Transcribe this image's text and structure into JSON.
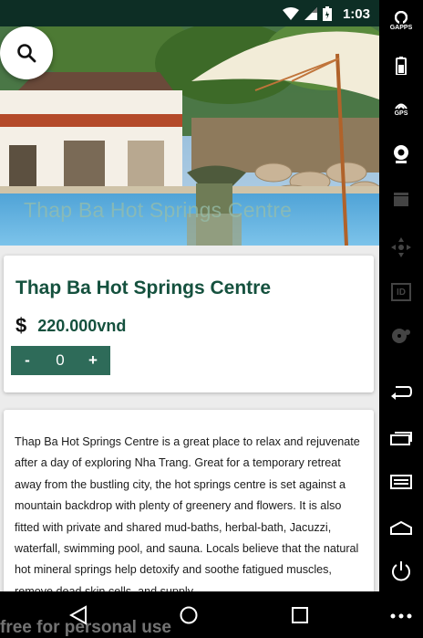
{
  "status_bar": {
    "time": "1:03"
  },
  "hero": {
    "overlay_title": "Thap Ba Hot Springs Centre"
  },
  "search": {
    "icon": "search-icon"
  },
  "product": {
    "title": "Thap Ba Hot Springs Centre",
    "currency_symbol": "$",
    "price": "220.000vnd",
    "stepper": {
      "minus": "-",
      "quantity": "0",
      "plus": "+"
    }
  },
  "description": {
    "text": "Thap Ba Hot Springs Centre is a great place to relax and rejuvenate after a day of exploring Nha Trang. Great for a temporary retreat away from the bustling city, the hot springs centre is set against a mountain backdrop with plenty of greenery and flowers. It is also fitted with private and shared mud-baths, herbal-bath, Jacuzzi, waterfall, swimming pool, and sauna. Locals believe that the natural hot mineral springs help detoxify and soothe fatigued muscles, remove dead skin cells, and supply"
  },
  "emulator_sidebar": {
    "gapps_label": "GAPPS",
    "gps_label": "GPS",
    "id_label": "ID"
  },
  "watermark": "free for personal use",
  "colors": {
    "accent": "#15513e",
    "stepper": "#2e6b59",
    "status_bar": "#0d2e25"
  }
}
